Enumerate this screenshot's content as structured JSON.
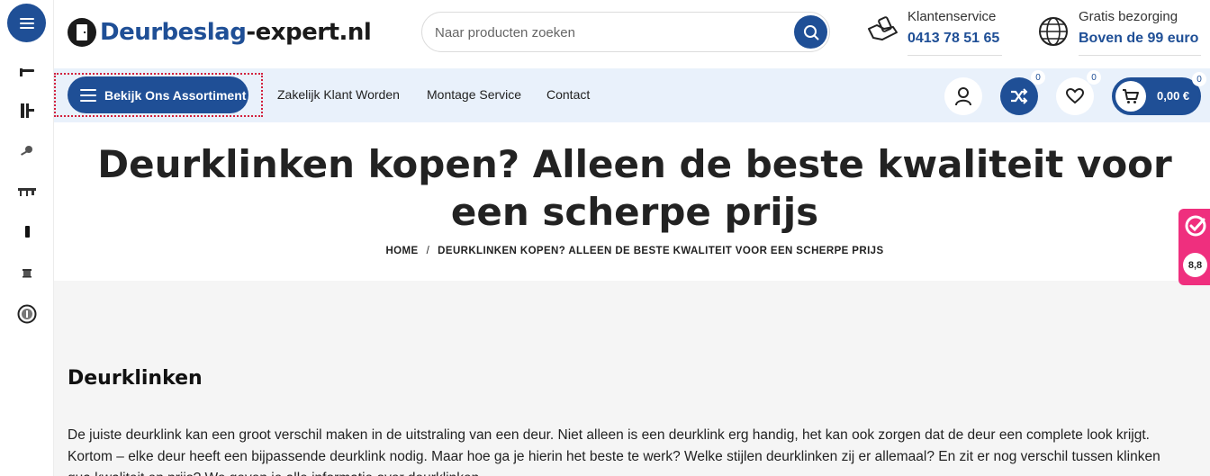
{
  "header": {
    "logo": {
      "part1": "Deurbeslag",
      "part2": "-expert.nl"
    },
    "search": {
      "placeholder": "Naar producten zoeken"
    },
    "customer_service": {
      "label": "Klantenservice",
      "value": "0413 78 51 65"
    },
    "shipping": {
      "label": "Gratis bezorging",
      "value": "Boven de 99 euro"
    }
  },
  "nav": {
    "assortment_button": "Bekijk Ons Assortiment",
    "links": [
      "Zakelijk Klant Worden",
      "Montage Service",
      "Contact"
    ],
    "compare_count": "0",
    "wishlist_count": "0",
    "cart": {
      "count": "0",
      "amount": "0,00 €"
    }
  },
  "sidebar": {
    "categories": [
      "door-handle-icon",
      "hinge-icon",
      "key-icon",
      "lock-set-icon",
      "door-stop-icon",
      "mail-slot-icon",
      "info-icon"
    ]
  },
  "page": {
    "title": "Deurklinken kopen? Alleen de beste kwaliteit voor een scherpe prijs",
    "breadcrumb": {
      "home": "HOME",
      "separator": "/",
      "current": "DEURKLINKEN KOPEN? ALLEEN DE BESTE KWALITEIT VOOR EEN SCHERPE PRIJS"
    },
    "section_heading": "Deurklinken",
    "paragraph": "De juiste deurklink kan een groot verschil maken in de uitstraling van een deur. Niet alleen is een deurklink erg handig, het kan ook zorgen dat de deur een complete look krijgt. Kortom – elke deur heeft een bijpassende deurklink nodig. Maar hoe ga je hierin het beste te werk? Welke stijlen deurklinken zij er allemaal? En zit er nog verschil tussen klinken qua kwaliteit en prijs? We geven je alle informatie over deurklinken."
  },
  "review_widget": {
    "score": "8,8"
  },
  "colors": {
    "brand_blue": "#1f4f96",
    "nav_bg": "#e9f1fb",
    "widget_pink": "#ef2f7e"
  }
}
